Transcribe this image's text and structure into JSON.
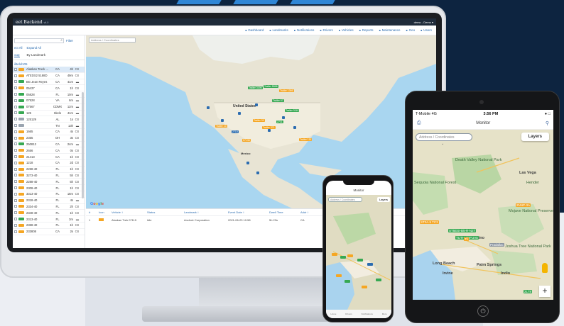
{
  "colors": {
    "navy": "#0d2440",
    "accent": "#2f86d6",
    "orange": "#f5a623",
    "green": "#36a852",
    "blue": "#2b6cb0"
  },
  "desktop": {
    "brand": "eet Backend",
    "version": "v4.0",
    "user": "demo - Demo ▾",
    "nav": [
      "Dashboard",
      "Landmarks",
      "Notifications",
      "Drivers",
      "Vehicles",
      "Reports",
      "Maintenance",
      "Geo",
      "Users"
    ],
    "search_filter_label": "Filter",
    "collapse_all": "ect All",
    "expand_all": "Expand All",
    "tabs": [
      "oup",
      "By Landmark"
    ],
    "group_label": "ilitelxl105",
    "map_search_placeholder": "Address / Coordinates",
    "map_labels": {
      "us": "United States",
      "mexico": "Mexico"
    },
    "google": [
      "G",
      "o",
      "o",
      "g",
      "l",
      "e"
    ],
    "rows": [
      {
        "name": "Alaskan Truck ...",
        "state": "CA",
        "time": "4h",
        "dir": "C8",
        "color": "#f5a623",
        "sel": true
      },
      {
        "name": "ATEDS2 5188D",
        "state": "CA",
        "time": "49m",
        "dir": "C8",
        "color": "#f5a623"
      },
      {
        "name": "BG Jean Reyes",
        "state": "CA",
        "time": "41m",
        "dir": "▬",
        "color": "#36a852"
      },
      {
        "name": "05437",
        "state": "CA",
        "time": "1h",
        "dir": "C8",
        "color": "#f5a623"
      },
      {
        "name": "05828",
        "state": "FL",
        "time": "10m",
        "dir": "▬",
        "color": "#36a852"
      },
      {
        "name": "07528",
        "state": "VA",
        "time": "6m",
        "dir": "▬",
        "color": "#36a852"
      },
      {
        "name": "07567",
        "state": "CDMX",
        "time": "12m",
        "dir": "▬",
        "color": "#36a852"
      },
      {
        "name": "125",
        "state": "Skelo",
        "time": "41m",
        "dir": "▬",
        "color": "#36a852"
      },
      {
        "name": "125129",
        "state": "AL",
        "time": "1s",
        "dir": "C8",
        "color": "#9aa4b0"
      },
      {
        "name": "",
        "state": "TN",
        "time": "13h",
        "dir": "▬",
        "color": "#9aa4b0"
      },
      {
        "name": "1665",
        "state": "CA",
        "time": "4s",
        "dir": "C8",
        "color": "#f5a623"
      },
      {
        "name": "2355",
        "state": "OH",
        "time": "3s",
        "dir": "C8",
        "color": "#f5a623"
      },
      {
        "name": "250813",
        "state": "CA",
        "time": "24m",
        "dir": "▬",
        "color": "#36a852"
      },
      {
        "name": "2656",
        "state": "CA",
        "time": "0s",
        "dir": "C8",
        "color": "#f5a623"
      },
      {
        "name": "21413",
        "state": "CA",
        "time": "1h",
        "dir": "C8",
        "color": "#f5a623"
      },
      {
        "name": "1218",
        "state": "CA",
        "time": "2d",
        "dir": "C8",
        "color": "#f5a623"
      },
      {
        "name": "2268-40",
        "state": "FL",
        "time": "1h",
        "dir": "C8",
        "color": "#f5a623"
      },
      {
        "name": "3273-40",
        "state": "FL",
        "time": "5h",
        "dir": "C8",
        "color": "#f5a623"
      },
      {
        "name": "2288-40",
        "state": "FL",
        "time": "5h",
        "dir": "C8",
        "color": "#f5a623"
      },
      {
        "name": "2308-40",
        "state": "FL",
        "time": "1h",
        "dir": "C8",
        "color": "#f5a623"
      },
      {
        "name": "3313-40",
        "state": "FL",
        "time": "18m",
        "dir": "C8",
        "color": "#f5a623"
      },
      {
        "name": "2318-40",
        "state": "FL",
        "time": "4s",
        "dir": "▬",
        "color": "#f5a623"
      },
      {
        "name": "2334-40",
        "state": "FL",
        "time": "2h",
        "dir": "C8",
        "color": "#f5a623"
      },
      {
        "name": "2348-40",
        "state": "FL",
        "time": "1h",
        "dir": "C8",
        "color": "#f5a623"
      },
      {
        "name": "2313-40",
        "state": "FL",
        "time": "3m",
        "dir": "▬",
        "color": "#36a852"
      },
      {
        "name": "2368-40",
        "state": "FL",
        "time": "1h",
        "dir": "C8",
        "color": "#f5a623"
      },
      {
        "name": "233808",
        "state": "CA",
        "time": "2s",
        "dir": "C8",
        "color": "#f5a623"
      }
    ],
    "table_head": [
      "#",
      "Icon",
      "Vehicle ↕",
      "Status",
      "Landmark ↕",
      "Event Date ↕",
      "Dwell Time",
      "Addr ↕"
    ],
    "table_row": [
      "1",
      "",
      "Alaskan Trek 07115",
      "Idle",
      "Anchotr Corporation",
      "2021-06-23 10:58",
      "5h 23s",
      "CA"
    ],
    "markers": [
      "Trailer 3196",
      "Trailer 5596",
      "Trailer 1066",
      "Trailer 57",
      "Trailer 3110",
      "Trailer 33",
      "Trailer 371",
      "2711",
      "Trailer 10",
      "2710",
      "57138",
      "Trailer 115"
    ]
  },
  "phone": {
    "title": "Monitor",
    "search_placeholder": "Address / Coordinates",
    "layers": "Layers",
    "tabs": [
      "Home",
      "Drivers",
      "Notifications",
      "More"
    ]
  },
  "tablet": {
    "carrier": "T-Mobile  4G",
    "time": "3:56 PM",
    "battery": "● □",
    "title": "Monitor",
    "search_placeholder": "Address / Coordinates",
    "layers": "Layers",
    "labels": {
      "death_valley": "Death Valley National Park",
      "las_vegas": "Las Vega",
      "henderson": "Hender",
      "sequoia": "Sequoia National Forest",
      "mojave": "Mojave National Preserve",
      "san_bernardino": "San Bernardino",
      "long_beach": "Long Beach",
      "irvine": "Irvine",
      "palm_springs": "Palm Springs",
      "joshua_tree": "Joshua Tree National Park",
      "indio": "Indio"
    },
    "markers": [
      "ST#A.5 TC3",
      "ST5ESI-B5-R-N2T",
      "TUTH-8DFUA5",
      "71",
      "Pradallac",
      "2L78",
      "2NNP-3A"
    ]
  }
}
